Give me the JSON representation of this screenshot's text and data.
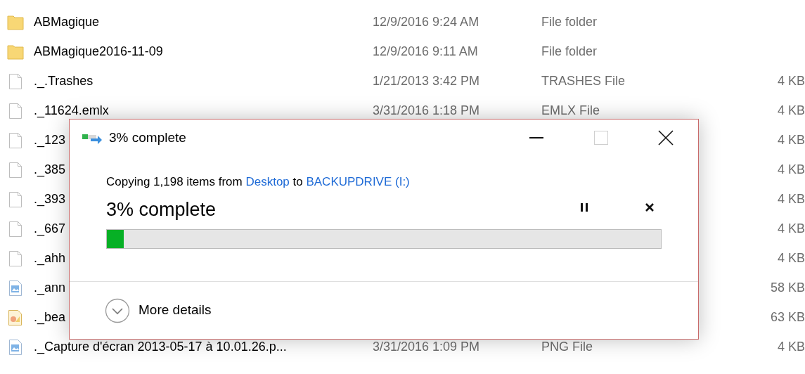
{
  "file_list": {
    "rows": [
      {
        "kind": "folder",
        "name": "ABMagique",
        "date_modified": "12/9/2016 9:24 AM",
        "type": "File folder"
      },
      {
        "kind": "folder",
        "name": "ABMagique2016-11-09",
        "date_modified": "12/9/2016 9:11 AM",
        "type": "File folder"
      },
      {
        "kind": "file",
        "name": "._.Trashes",
        "date_modified": "1/21/2013 3:42 PM",
        "type": "TRASHES File",
        "size": "4 KB"
      },
      {
        "kind": "file",
        "name": "._11624.emlx",
        "date_modified": "3/31/2016 1:18 PM",
        "type": "EMLX File",
        "size": "4 KB"
      },
      {
        "kind": "file",
        "name": "._123",
        "size": "4 KB"
      },
      {
        "kind": "file",
        "name": "._385",
        "size": "4 KB"
      },
      {
        "kind": "file",
        "name": "._393",
        "size": "4 KB"
      },
      {
        "kind": "file",
        "name": "._667",
        "size": "4 KB"
      },
      {
        "kind": "file",
        "name": "._ahh",
        "size": "4 KB"
      },
      {
        "kind": "image",
        "name": "._ann",
        "size": "58 KB"
      },
      {
        "kind": "drawing",
        "name": "._bea",
        "size": "63 KB"
      },
      {
        "kind": "image",
        "name": "._Capture d'écran 2013-05-17 à 10.01.26.p...",
        "date_modified": "3/31/2016 1:09 PM",
        "type": "PNG File",
        "size": "4 KB"
      }
    ]
  },
  "dialog": {
    "title": "3% complete",
    "maximize_disabled": true,
    "message": [
      {
        "kind": "text",
        "text": "Copying 1,198 items from "
      },
      {
        "kind": "link",
        "text": "Desktop"
      },
      {
        "kind": "text",
        "text": " to "
      },
      {
        "kind": "link",
        "text": "BACKUPDRIVE (I:)"
      }
    ],
    "status": "3% complete",
    "progress": {
      "level": 0.03
    },
    "details": {
      "label": "More details",
      "expanded": false
    }
  }
}
